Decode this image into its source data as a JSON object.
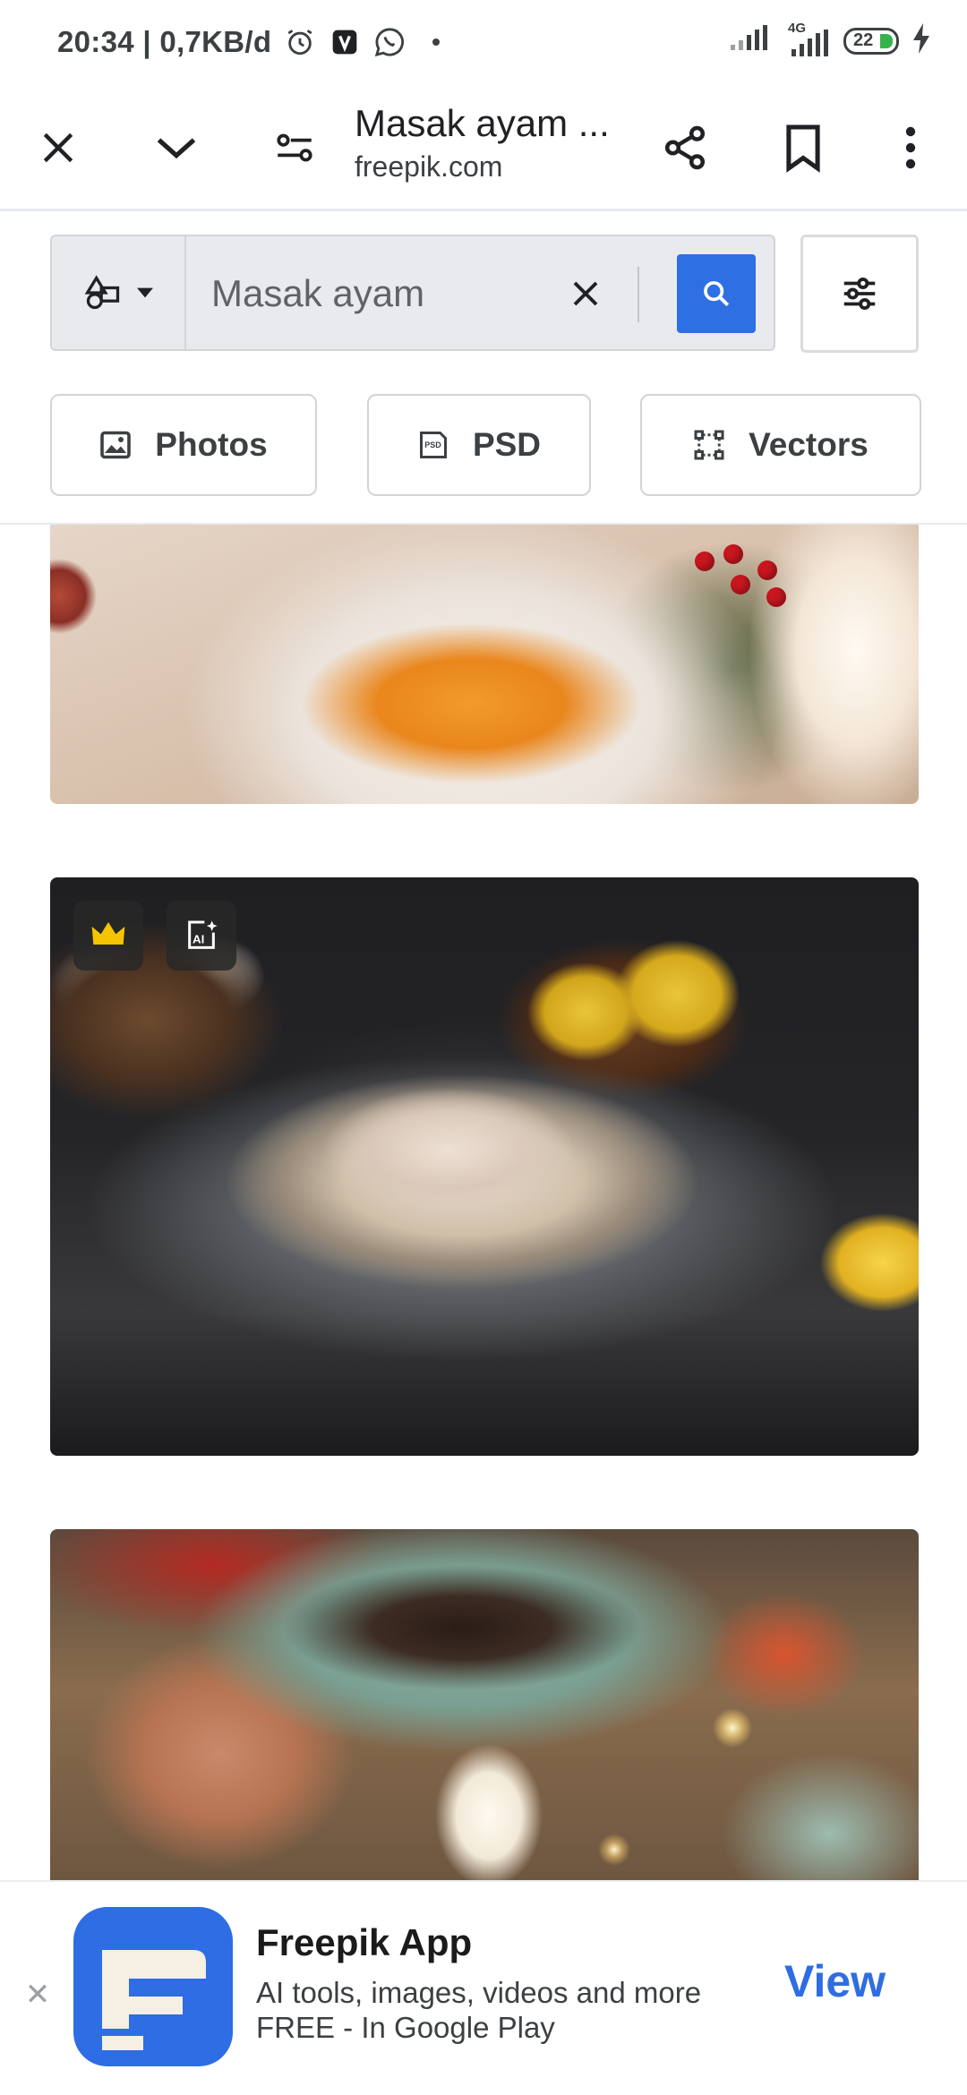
{
  "status_bar": {
    "time_speed": "20:34 | 0,7KB/d",
    "network": "4G",
    "battery": "22",
    "icons": [
      "alarm-icon",
      "app-notification-icon",
      "whatsapp-icon",
      "dot-icon",
      "signal-icon",
      "signal-4g-icon",
      "battery-icon",
      "charging-icon"
    ]
  },
  "toolbar": {
    "title": "Masak ayam ...",
    "domain": "freepik.com",
    "icons": [
      "close-icon",
      "chevron-down-icon",
      "site-settings-icon",
      "share-icon",
      "bookmark-icon",
      "more-vert-icon"
    ]
  },
  "search": {
    "query": "Masak ayam",
    "icons": [
      "shapes-icon",
      "caret-down-icon",
      "clear-icon",
      "search-icon",
      "filter-sliders-icon"
    ]
  },
  "categories": [
    {
      "label": "Photos",
      "icon": "photo-icon"
    },
    {
      "label": "PSD",
      "icon": "psd-icon"
    },
    {
      "label": "Vectors",
      "icon": "vector-icon"
    }
  ],
  "results": [
    {
      "description_icons": []
    },
    {
      "badges": [
        "premium-crown-icon",
        "ai-generated-icon"
      ]
    },
    {
      "description_icons": []
    }
  ],
  "app_banner": {
    "title": "Freepik App",
    "line1": "AI tools, images, videos and more",
    "line2": "FREE - In Google Play",
    "cta": "View",
    "close_glyph": "✕",
    "accent": "#2e6de3"
  }
}
